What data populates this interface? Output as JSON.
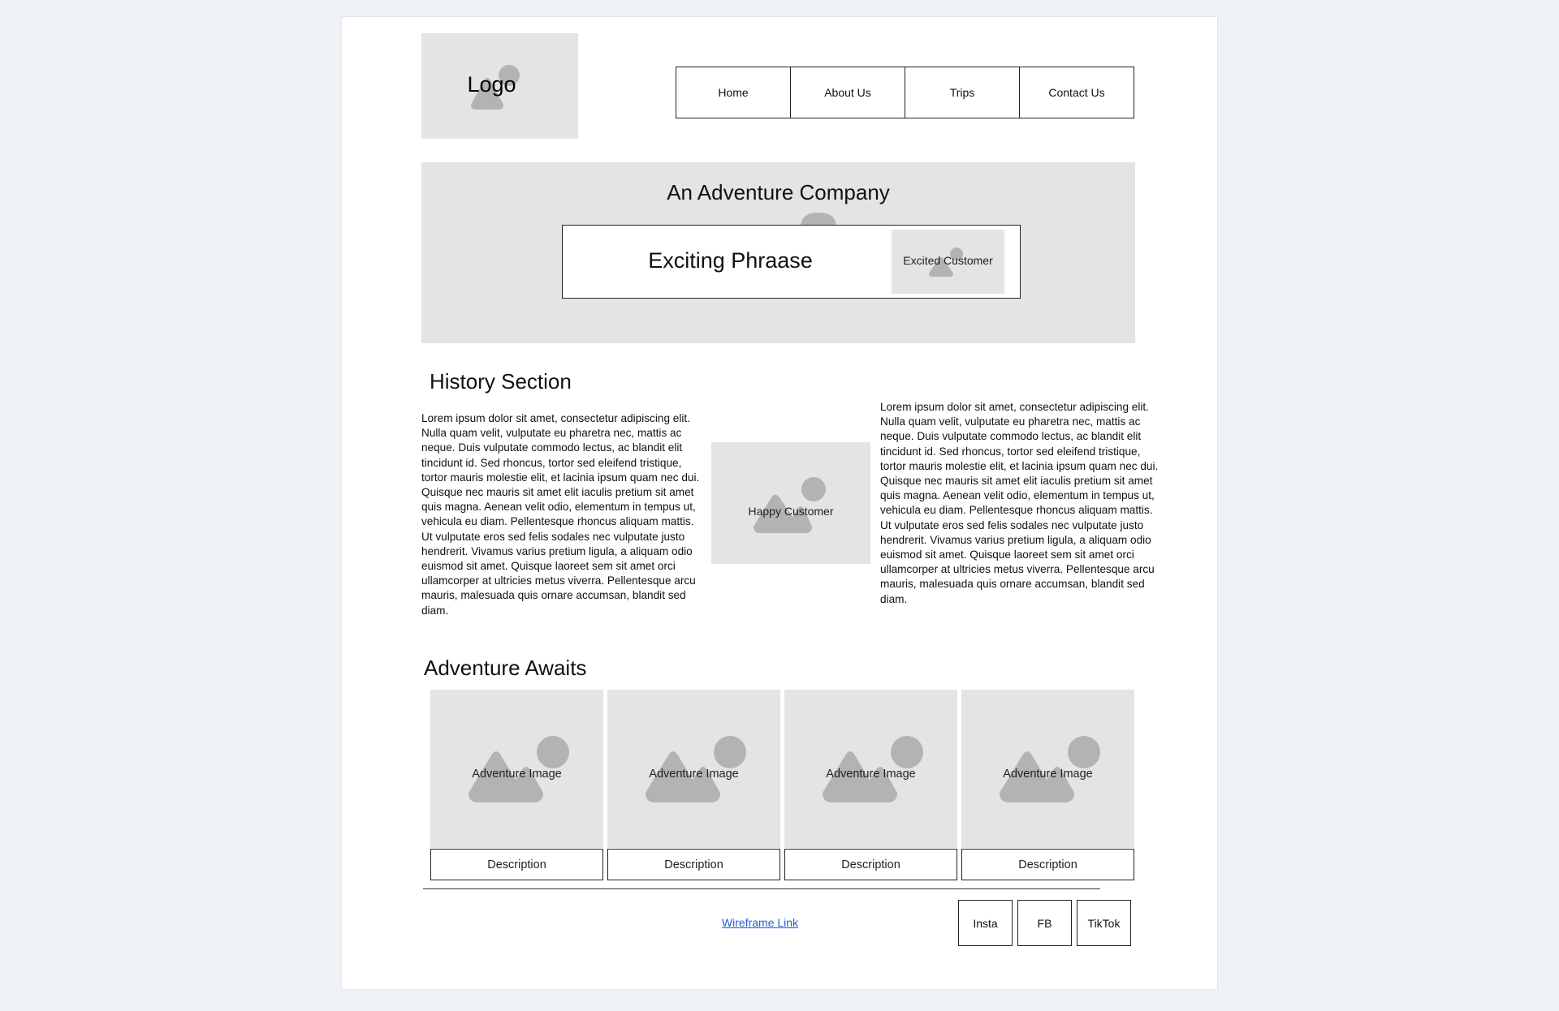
{
  "header": {
    "logo_label": "Logo",
    "nav": [
      {
        "label": "Home"
      },
      {
        "label": "About Us"
      },
      {
        "label": "Trips"
      },
      {
        "label": "Contact Us"
      }
    ]
  },
  "hero": {
    "title": "An Adventure Company",
    "phrase": "Exciting Phraase",
    "image_label": "Excited Customer"
  },
  "history": {
    "title": "History Section",
    "left_text": "Lorem ipsum dolor sit amet, consectetur adipiscing elit. Nulla quam velit, vulputate eu pharetra nec, mattis ac neque. Duis vulputate commodo lectus, ac blandit elit tincidunt id. Sed rhoncus, tortor sed eleifend tristique, tortor mauris molestie elit, et lacinia ipsum quam nec dui. Quisque nec mauris sit amet elit iaculis pretium sit amet quis magna. Aenean velit odio, elementum in tempus ut, vehicula eu diam. Pellentesque rhoncus aliquam mattis. Ut vulputate eros sed felis sodales nec vulputate justo hendrerit. Vivamus varius pretium ligula, a aliquam odio euismod sit amet. Quisque laoreet sem sit amet orci ullamcorper at ultricies metus viverra. Pellentesque arcu mauris, malesuada quis ornare accumsan, blandit sed diam.",
    "image_label": "Happy Customer",
    "right_text": "Lorem ipsum dolor sit amet, consectetur adipiscing elit. Nulla quam velit, vulputate eu pharetra nec, mattis ac neque. Duis vulputate commodo lectus, ac blandit elit tincidunt id. Sed rhoncus, tortor sed eleifend tristique, tortor mauris molestie elit, et lacinia ipsum quam nec dui. Quisque nec mauris sit amet elit iaculis pretium sit amet quis magna. Aenean velit odio, elementum in tempus ut, vehicula eu diam. Pellentesque rhoncus aliquam mattis. Ut vulputate eros sed felis sodales nec vulputate justo hendrerit. Vivamus varius pretium ligula, a aliquam odio euismod sit amet. Quisque laoreet sem sit amet orci ullamcorper at ultricies metus viverra. Pellentesque arcu mauris, malesuada quis ornare accumsan, blandit sed diam."
  },
  "adventure": {
    "title": "Adventure Awaits",
    "cards": [
      {
        "image_label": "Adventure Image",
        "description": "Description"
      },
      {
        "image_label": "Adventure Image",
        "description": "Description"
      },
      {
        "image_label": "Adventure Image",
        "description": "Description"
      },
      {
        "image_label": "Adventure Image",
        "description": "Description"
      }
    ]
  },
  "footer": {
    "link_label": "Wireframe Link",
    "social": [
      {
        "label": "Insta"
      },
      {
        "label": "FB"
      },
      {
        "label": "TikTok"
      }
    ]
  },
  "colors": {
    "background": "#eef1f5",
    "placeholder": "#e4e4e4",
    "placeholder_art": "#b3b3b3",
    "link": "#1a63d6"
  },
  "icons": {
    "image_placeholder": "image-placeholder-icon"
  }
}
